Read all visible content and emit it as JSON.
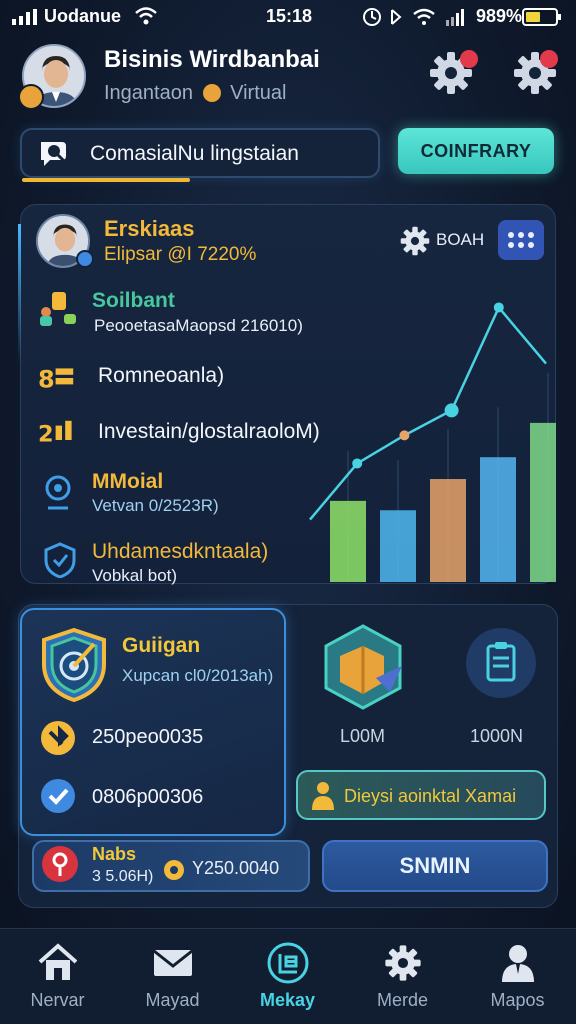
{
  "status_bar": {
    "carrier": "Uodanue",
    "time": "15:18",
    "battery_pct": "989%"
  },
  "header": {
    "title": "Bisinis Wirdbanbai",
    "subtitle_left": "Ingantaon",
    "subtitle_right": "Virtual"
  },
  "search": {
    "text": "ComasialNu lingstaian",
    "button_label": "COINFRARY"
  },
  "profile": {
    "name": "Erskiaas",
    "detail": "Elipsar @I 7220%",
    "gear_label": "BOAH"
  },
  "rows": [
    {
      "title": "Soilbant",
      "sub": "PeooetasaMaopsd 216010)"
    },
    {
      "title": "Romneoanla)"
    },
    {
      "title": "Investain/glostalraoloM)"
    },
    {
      "title": "MMoial",
      "sub": "Vetvan 0/2523R)"
    },
    {
      "title": "Uhdamesdkntaala)",
      "sub": "Vobkal bot)"
    }
  ],
  "chart_data": {
    "type": "bar",
    "categories": [
      "",
      "",
      "",
      "",
      ""
    ],
    "values": [
      26,
      23,
      33,
      40,
      51
    ],
    "line_overlay": [
      20,
      38,
      47,
      55,
      88,
      70
    ],
    "xlabel": "",
    "ylabel": "",
    "colors": [
      "#8fe36a",
      "#4fb7f0",
      "#e8a36a",
      "#54b6f2",
      "#7fd98a"
    ]
  },
  "guide": {
    "title": "Guiigan",
    "sub": "Xupcan cl0/2013ah)",
    "stat1": "250peo0035",
    "stat2": "0806p00306"
  },
  "cube": {
    "label": "L00M"
  },
  "doc": {
    "label": "1000N"
  },
  "info_pill": {
    "text": "Dieysi aoinktal Xamai"
  },
  "promo": {
    "title": "Nabs",
    "sub": "3 5.06H)",
    "value": "Y250.0040"
  },
  "signin": {
    "label": "SNMIN"
  },
  "tabs": [
    {
      "label": "Nervar",
      "icon": "home-icon"
    },
    {
      "label": "Mayad",
      "icon": "mail-icon"
    },
    {
      "label": "Mekay",
      "icon": "ledger-icon",
      "active": true
    },
    {
      "label": "Merde",
      "icon": "gear-icon"
    },
    {
      "label": "Mapos",
      "icon": "person-icon"
    }
  ],
  "colors": {
    "accent_teal": "#49d2e2",
    "accent_gold": "#f2b93a",
    "background": "#0f1a2d",
    "notification": "#e23a4a"
  }
}
